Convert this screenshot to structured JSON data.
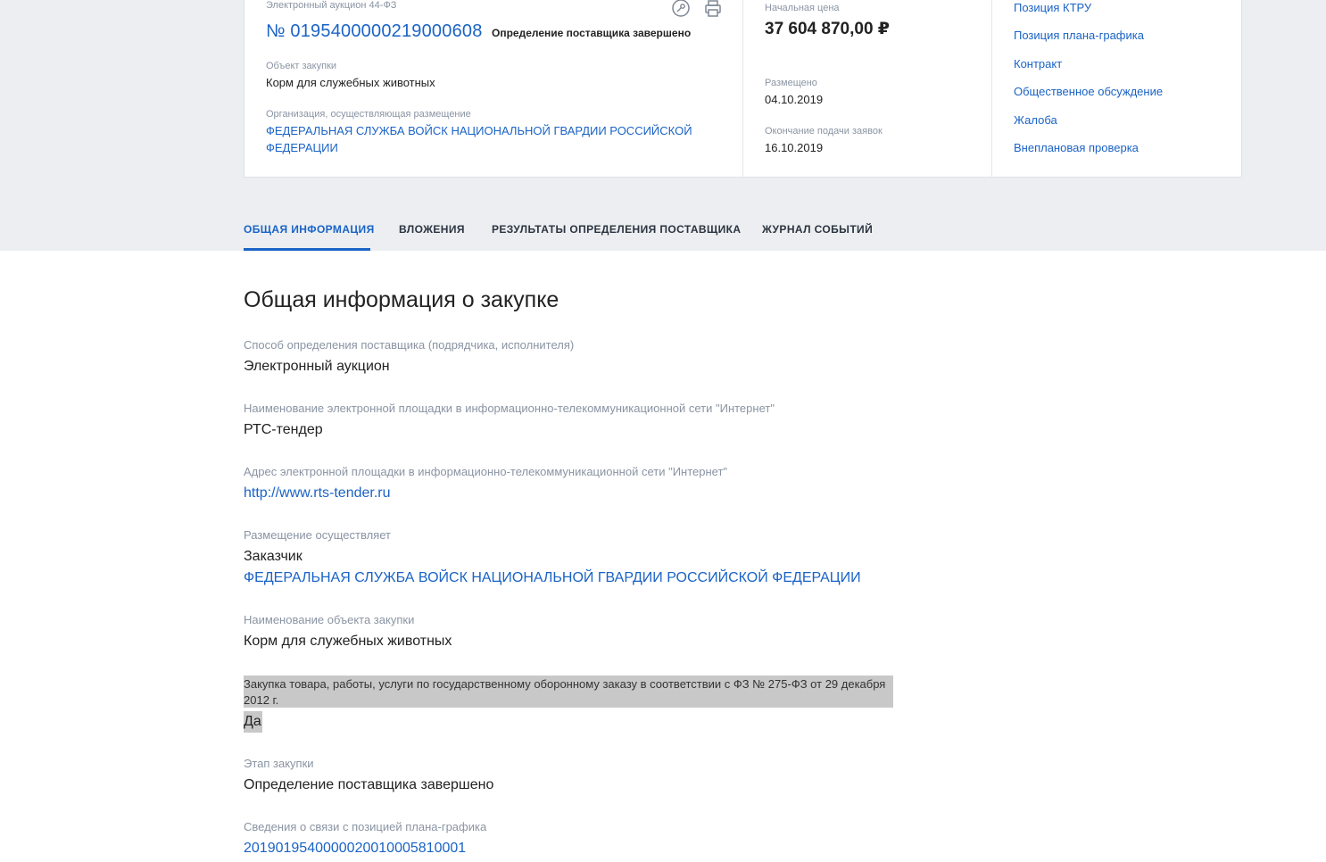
{
  "card": {
    "procedure_type": "Электронный аукцион 44-ФЗ",
    "reg_number": "№ 0195400000219000608",
    "status": "Определение поставщика завершено",
    "object_label": "Объект закупки",
    "object_value": "Корм для служебных животных",
    "org_label": "Организация, осуществляющая размещение",
    "org_line1": "ФЕДЕРАЛЬНАЯ СЛУЖБА ВОЙСК НАЦИОНАЛЬНОЙ ГВАРДИИ РОССИЙСКОЙ",
    "org_line2": "ФЕДЕРАЦИИ",
    "price_label": "Начальная цена",
    "price_value": "37 604 870,00 ₽",
    "posted_label": "Размещено",
    "posted_value": "04.10.2019",
    "deadline_label": "Окончание подачи заявок",
    "deadline_value": "16.10.2019",
    "side_links": [
      "Позиция КТРУ",
      "Позиция плана-графика",
      "Контракт",
      "Общественное обсуждение",
      "Жалоба",
      "Внеплановая проверка"
    ],
    "icons": [
      "key-icon",
      "print-icon"
    ]
  },
  "tabs": [
    "ОБЩАЯ ИНФОРМАЦИЯ",
    "ВЛОЖЕНИЯ",
    "РЕЗУЛЬТАТЫ ОПРЕДЕЛЕНИЯ ПОСТАВЩИКА",
    "ЖУРНАЛ СОБЫТИЙ"
  ],
  "section_title": "Общая информация о закупке",
  "fields": {
    "method_label": "Способ определения поставщика (подрядчика, исполнителя)",
    "method_value": "Электронный аукцион",
    "platform_name_label": "Наименование электронной площадки в информационно-телекоммуникационной сети \"Интернет\"",
    "platform_name_value": "РТС-тендер",
    "platform_addr_label": "Адрес электронной площадки в информационно-телекоммуникационной сети \"Интернет\"",
    "platform_addr_value": "http://www.rts-tender.ru",
    "placement_label": "Размещение осуществляет",
    "placement_role": "Заказчик",
    "placement_org": "ФЕДЕРАЛЬНАЯ СЛУЖБА ВОЙСК НАЦИОНАЛЬНОЙ ГВАРДИИ РОССИЙСКОЙ ФЕДЕРАЦИИ",
    "object_label": "Наименование объекта закупки",
    "object_value": "Корм для служебных животных",
    "defense_label": "Закупка товара, работы, услуги по государственному оборонному заказу в соответствии с ФЗ № 275-ФЗ от 29 декабря 2012 г.",
    "defense_value": "Да",
    "stage_label": "Этап закупки",
    "stage_value": "Определение поставщика завершено",
    "plan_label": "Сведения о связи с позицией плана-графика",
    "plan_value": "201901954000002001000581000​1"
  }
}
